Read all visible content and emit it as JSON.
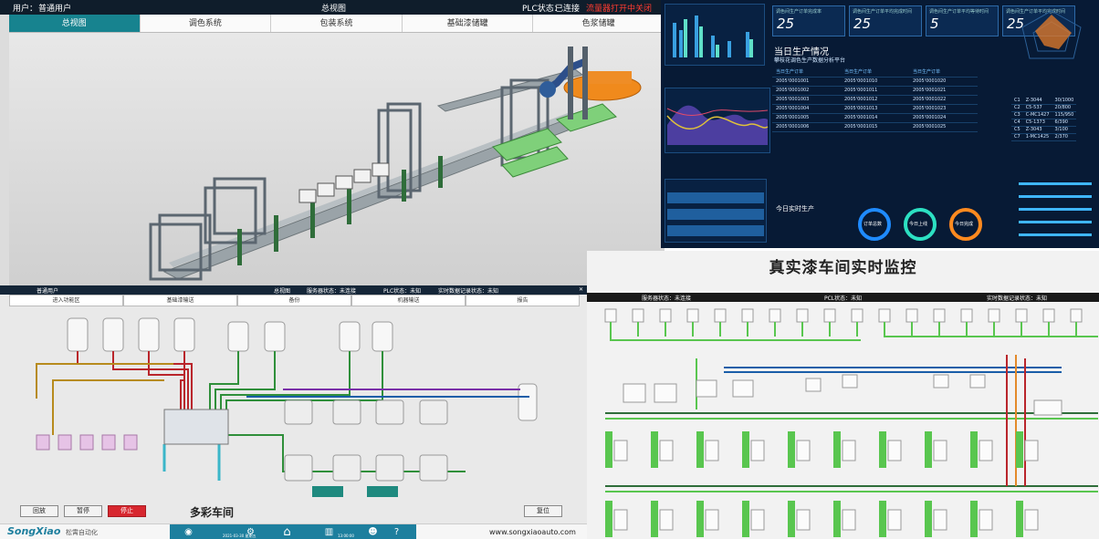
{
  "panel_a": {
    "user_label": "用户：",
    "user_value": "普通用户",
    "center_title": "总视图",
    "plc_label": "PLC状态：",
    "plc_value": "已连接",
    "alarm_text": "流量器打开中关闭",
    "tabs": [
      "总视图",
      "调色系统",
      "包装系统",
      "基础漆储罐",
      "色浆储罐"
    ]
  },
  "panel_b": {
    "kpis": [
      {
        "title": "调色间生产订单完成率",
        "value": "25"
      },
      {
        "title": "调色间生产订单平均完成时间",
        "value": "25"
      },
      {
        "title": "调色间生产订单平均等待时间",
        "value": "5"
      },
      {
        "title": "调色间生产订单平均完成时间",
        "value": "25"
      }
    ],
    "prod_title": "当日生产情况",
    "prod_subtitle": "攀枝花调色生产数据分析平台",
    "prod_headers": [
      "当日生产订单",
      "当日生产订单",
      "当日生产订单"
    ],
    "prod_rows": [
      [
        "2005'0001001",
        "2005'0001010",
        "2005'0001020"
      ],
      [
        "2005'0001002",
        "2005'0001011",
        "2005'0001021"
      ],
      [
        "2005'0001003",
        "2005'0001012",
        "2005'0001022"
      ],
      [
        "2005'0001004",
        "2005'0001013",
        "2005'0001023"
      ],
      [
        "2005'0001005",
        "2005'0001014",
        "2005'0001024"
      ],
      [
        "2005'0001006",
        "2005'0001015",
        "2005'0001025"
      ]
    ],
    "right_rows": [
      [
        "C1",
        "Z-3044",
        "30/1000"
      ],
      [
        "C2",
        "C5-537",
        "20/800"
      ],
      [
        "C3",
        "C-MC1427",
        "115/950"
      ],
      [
        "C4",
        "C5-1373",
        "6/390"
      ],
      [
        "C5",
        "Z-3043",
        "3/100"
      ],
      [
        "C7",
        "1-MC1425",
        "2/370"
      ]
    ],
    "realtime_title": "今日实时生产",
    "rings": [
      "订单总数",
      "今日上线",
      "今日完成"
    ]
  },
  "panel_c": {
    "user_value": "普通用户",
    "center_title": "总视图",
    "status_1": "服务器状态：未连接",
    "status_2": "PLC状态：未知",
    "status_3": "实时数据记录状态：未知",
    "tabs": [
      "进入功能区",
      "基础漆输送",
      "备份",
      "机器输送",
      "报告"
    ],
    "btn_return": "回放",
    "btn_pause": "暂停",
    "btn_stop": "停止",
    "btn_reset": "复位",
    "workshop_title": "多彩车间",
    "brand": "SongXiao",
    "brand_cn": "松霄自动化",
    "website": "www.songxiaoauto.com",
    "date_text": "2021-03-30 星期五",
    "time_text": "13:00:00"
  },
  "panel_d": {
    "title": "真实漆车间实时监控",
    "status_1": "服务器状态：未连接",
    "status_2": "PCL状态：未知",
    "status_3": "实时数据记录状态：未知"
  },
  "colors": {
    "dash_bg": "#071a35",
    "teal": "#17838f",
    "pipe_green": "#59c64f",
    "pipe_red": "#b9252b",
    "pipe_blue": "#1a5ea8"
  }
}
